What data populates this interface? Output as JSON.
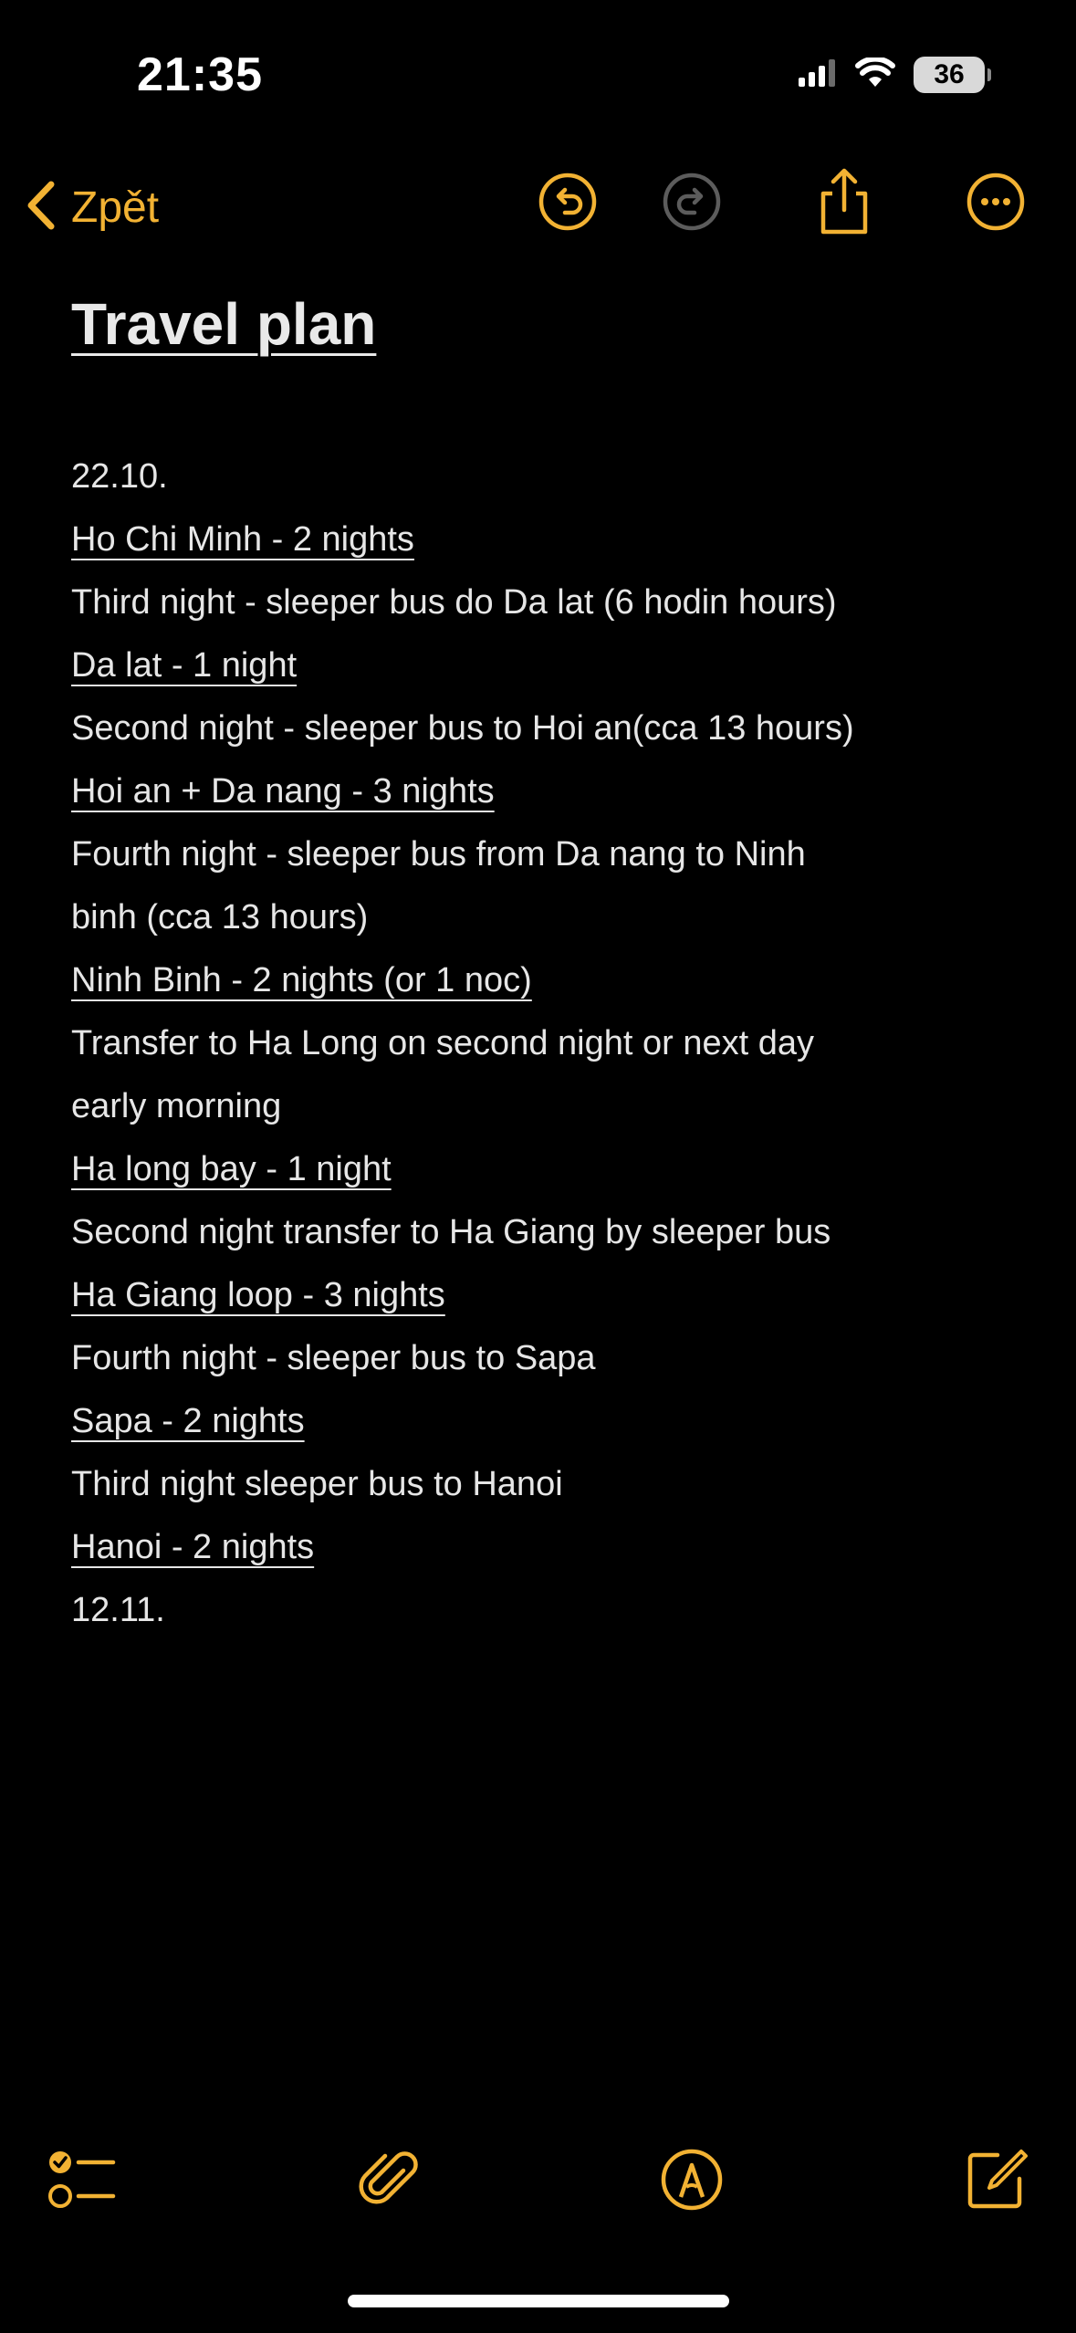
{
  "status": {
    "time": "21:35",
    "battery": "36"
  },
  "nav": {
    "back_label": "Zpět"
  },
  "note": {
    "title": "Travel plan",
    "lines": [
      {
        "text": "22.10.",
        "underline": false
      },
      {
        "text": "Ho Chi Minh - 2 nights",
        "underline": true
      },
      {
        "text": "Third night - sleeper bus do Da lat (6 hodin hours)",
        "underline": false
      },
      {
        "text": "Da lat - 1 night",
        "underline": true
      },
      {
        "text": "Second night - sleeper bus to Hoi an(cca 13 hours)",
        "underline": false
      },
      {
        "text": "Hoi an + Da nang - 3 nights",
        "underline": true
      },
      {
        "text": "Fourth night - sleeper bus from Da nang to Ninh",
        "underline": false
      },
      {
        "text": "binh (cca 13 hours)",
        "underline": false
      },
      {
        "text": "Ninh Binh - 2 nights (or 1 noc)",
        "underline": true
      },
      {
        "text": "Transfer to Ha Long on second night or next day",
        "underline": false
      },
      {
        "text": "early morning",
        "underline": false
      },
      {
        "text": "Ha long bay - 1 night",
        "underline": true
      },
      {
        "text": "Second night transfer to Ha Giang by sleeper bus",
        "underline": false
      },
      {
        "text": "Ha Giang loop - 3 nights",
        "underline": true
      },
      {
        "text": "Fourth night - sleeper bus to Sapa",
        "underline": false
      },
      {
        "text": "Sapa - 2 nights",
        "underline": true
      },
      {
        "text": "Third night sleeper bus to Hanoi",
        "underline": false
      },
      {
        "text": "Hanoi - 2 nights",
        "underline": true
      },
      {
        "text": "12.11.",
        "underline": false
      }
    ]
  },
  "colors": {
    "accent": "#f2b233",
    "background": "#000000",
    "text": "#e6e6e6"
  }
}
